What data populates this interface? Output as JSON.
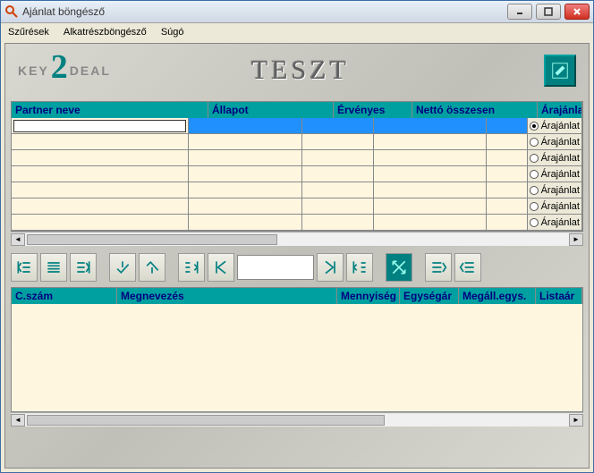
{
  "window": {
    "title": "Ajánlat böngésző"
  },
  "menu": {
    "szuresek": "Szűrések",
    "alkatresz": "Alkatrészböngésző",
    "sugo": "Súgó"
  },
  "branding": {
    "key": "KEY",
    "two": "2",
    "deal": "DEAL",
    "watermark": "TESZT"
  },
  "grid1": {
    "headers": {
      "partner": "Partner neve",
      "allapot": "Állapot",
      "ervenyes": "Érvényes",
      "netto": "Nettó összesen",
      "arajanlat_col": "Árajánlat|Á"
    },
    "option_label": "Árajánlat",
    "rows": [
      {
        "selected": true,
        "radio": true
      },
      {
        "selected": false,
        "radio": false
      },
      {
        "selected": false,
        "radio": false
      },
      {
        "selected": false,
        "radio": false
      },
      {
        "selected": false,
        "radio": false
      },
      {
        "selected": false,
        "radio": false
      },
      {
        "selected": false,
        "radio": false
      }
    ]
  },
  "grid2": {
    "headers": {
      "cszam": "C.szám",
      "megnevezes": "Megnevezés",
      "mennyiseg": "Mennyiség",
      "egysegar": "Egységár",
      "megall": "Megáll.egys.",
      "listaar": "Listaár"
    }
  }
}
